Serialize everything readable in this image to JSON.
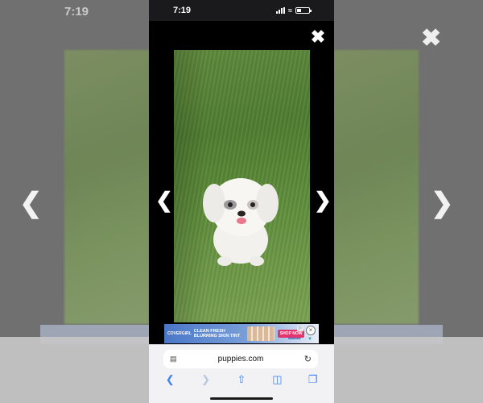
{
  "status": {
    "time": "7:19",
    "battery_level": 0.3
  },
  "viewer": {
    "close_icon": "close-icon",
    "prev_icon": "chevron-left-icon",
    "next_icon": "chevron-right-icon",
    "photo_subject": "dog-photo"
  },
  "ad": {
    "brand": "COVERGIRL",
    "headline": "CLEAN FRESH BLURRING SKIN TINT",
    "shop_label": "SHOP NOW",
    "retailer": "Walmart",
    "new_badge": "NEW"
  },
  "browser": {
    "url": "puppies.com",
    "tools": [
      "back-icon",
      "forward-icon",
      "share-icon",
      "bookmarks-icon",
      "tabs-icon"
    ]
  },
  "background": {
    "time": "7:19"
  }
}
